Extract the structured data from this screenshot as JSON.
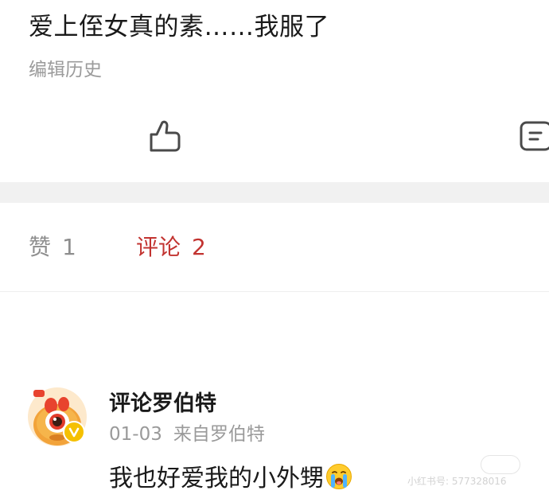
{
  "post": {
    "text": "爱上侄女真的素……我服了",
    "edit_history_label": "编辑历史"
  },
  "actions": {
    "like_icon": "thumbs-up-outline-icon",
    "comment_icon": "comment-bubble-outline-icon"
  },
  "tabs": {
    "likes_label": "赞",
    "likes_count": "1",
    "comments_label": "评论",
    "comments_count": "2",
    "active_color": "#c23330",
    "inactive_color": "#8e8e8e"
  },
  "comment": {
    "author": "评论罗伯特",
    "date": "01-03",
    "source": "来自罗伯特",
    "text": "我也好爱我的小外甥",
    "emoji": "crying-face-emoji",
    "avatar_icon": "one-eyed-mascot-avatar-icon"
  },
  "watermark": {
    "text": "小红书号: 577328016"
  }
}
